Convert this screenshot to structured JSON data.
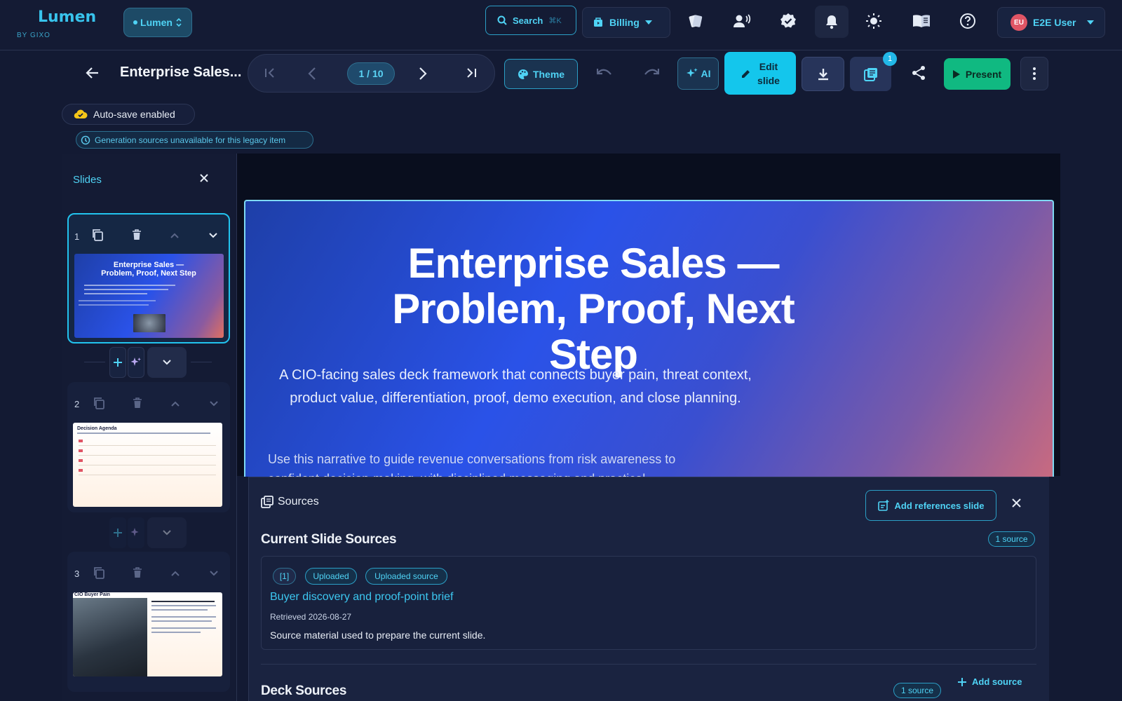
{
  "brand": {
    "name": "Lumen",
    "tagline": "BY GIXO"
  },
  "workspace": {
    "label": "Lumen"
  },
  "search": {
    "label": "Search",
    "shortcut": "⌘K"
  },
  "billing": {
    "label": "Billing"
  },
  "user": {
    "initials": "EU",
    "name": "E2E User"
  },
  "deck": {
    "title": "Enterprise Sales..."
  },
  "pager": {
    "indicator": "1 / 10"
  },
  "toolbar": {
    "theme": "Theme",
    "ai": "AI",
    "edit_line1": "Edit",
    "edit_line2": "slide",
    "sources_badge": "1",
    "present": "Present"
  },
  "status": {
    "autosave": "Auto-save enabled",
    "legacy": "Generation sources unavailable for this legacy item"
  },
  "sidebar": {
    "title": "Slides",
    "slides": [
      {
        "number": "1",
        "thumb_title": "Enterprise Sales — Problem, Proof, Next Step"
      },
      {
        "number": "2",
        "thumb_title": "Decision Agenda"
      },
      {
        "number": "3",
        "thumb_title": "CIO Buyer Pain"
      }
    ]
  },
  "slide": {
    "title": "Enterprise Sales — Problem, Proof, Next Step",
    "subtitle": "A CIO-facing sales deck framework that connects buyer pain, threat context, product value, differentiation, proof, demo execution, and close planning.",
    "body": "Use this narrative to guide revenue conversations from risk awareness to confident decision-making, with disciplined messaging and practical..."
  },
  "sources": {
    "panel_title": "Sources",
    "add_references": "Add references slide",
    "current_heading": "Current Slide Sources",
    "current_count": "1 source",
    "items": [
      {
        "index": "[1]",
        "tag1": "Uploaded",
        "tag2": "Uploaded source",
        "title": "Buyer discovery and proof-point brief",
        "retrieved": "Retrieved 2026-08-27",
        "description": "Source material used to prepare the current slide."
      }
    ],
    "deck_heading": "Deck Sources",
    "deck_count": "1 source",
    "add_source": "Add source"
  },
  "colors": {
    "accent": "#22c3ee",
    "background": "#131a33",
    "present": "#10b981"
  }
}
